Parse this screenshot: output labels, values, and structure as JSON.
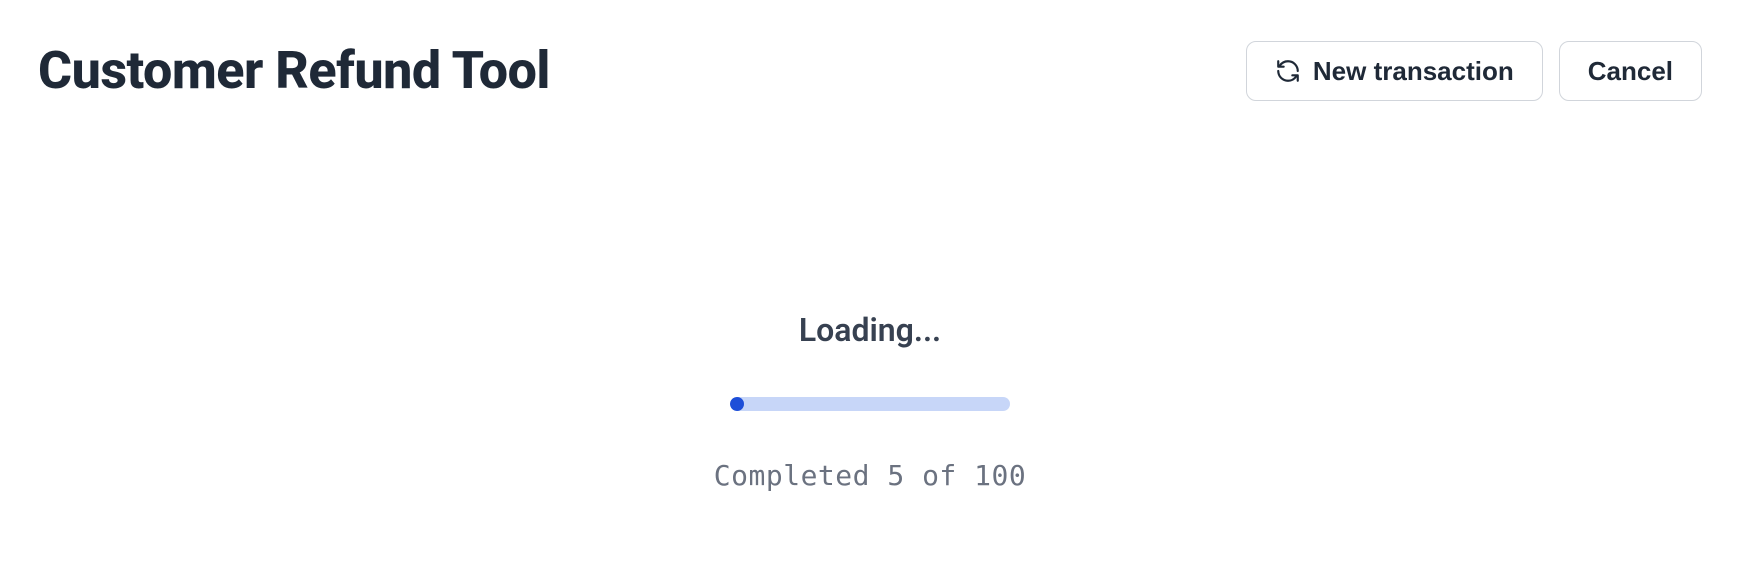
{
  "header": {
    "title": "Customer Refund Tool",
    "actions": {
      "new_transaction_label": "New transaction",
      "cancel_label": "Cancel"
    }
  },
  "loading": {
    "text": "Loading...",
    "progress_percent": 5,
    "status_text": "Completed 5 of 100"
  }
}
